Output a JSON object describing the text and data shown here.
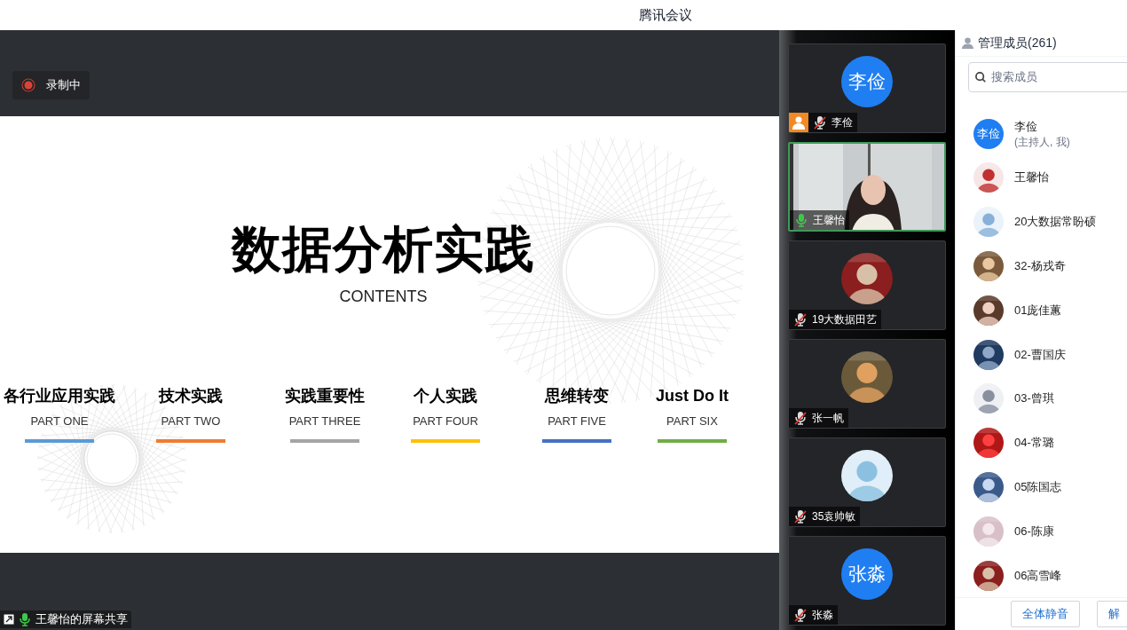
{
  "window": {
    "title": "腾讯会议"
  },
  "recording": {
    "label": "录制中"
  },
  "slide": {
    "title": "数据分析实践",
    "subtitle": "CONTENTS",
    "parts": [
      {
        "title": "各行业应用实践",
        "label": "PART ONE",
        "color": "#5b9bd5"
      },
      {
        "title": "技术实践",
        "label": "PART TWO",
        "color": "#ed7d31"
      },
      {
        "title": "实践重要性",
        "label": "PART THREE",
        "color": "#a5a5a5"
      },
      {
        "title": "个人实践",
        "label": "PART FOUR",
        "color": "#ffc000"
      },
      {
        "title": "思维转变",
        "label": "PART FIVE",
        "color": "#4472c4"
      },
      {
        "title": "Just Do It",
        "label": "PART SIX",
        "color": "#70ad47"
      }
    ]
  },
  "share_label": {
    "text": "王馨怡的屏幕共享",
    "muted": false
  },
  "video_tiles": [
    {
      "name": "李俭",
      "kind": "text_avatar",
      "avatar_text": "李俭",
      "muted": true,
      "speaking": false,
      "host": true
    },
    {
      "name": "王馨怡",
      "kind": "video",
      "muted": false,
      "speaking": true,
      "host": false
    },
    {
      "name": "19大数据田艺",
      "kind": "picture_avatar",
      "muted": true,
      "speaking": false,
      "host": false
    },
    {
      "name": "张一帆",
      "kind": "picture_avatar",
      "muted": true,
      "speaking": false,
      "host": false
    },
    {
      "name": "35袁帅敏",
      "kind": "picture_avatar",
      "muted": true,
      "speaking": false,
      "host": false
    },
    {
      "name": "张淼",
      "kind": "text_avatar",
      "avatar_text": "张淼",
      "muted": true,
      "speaking": false,
      "host": false
    }
  ],
  "members": {
    "title": "管理成员(261)",
    "search": {
      "placeholder": "搜索成员"
    },
    "items": [
      {
        "name": "李俭",
        "note": "(主持人, 我)",
        "kind": "text_avatar",
        "avatar_text": "李俭"
      },
      {
        "name": "王馨怡",
        "kind": "picture"
      },
      {
        "name": "20大数据常盼硕",
        "kind": "picture"
      },
      {
        "name": "32-杨戎奇",
        "kind": "picture"
      },
      {
        "name": "01庞佳蕙",
        "kind": "picture"
      },
      {
        "name": "02-曹国庆",
        "kind": "picture"
      },
      {
        "name": "03-曾琪",
        "kind": "picture"
      },
      {
        "name": "04-常璐",
        "kind": "picture"
      },
      {
        "name": "05陈国志",
        "kind": "picture"
      },
      {
        "name": "06-陈康",
        "kind": "picture"
      },
      {
        "name": "06高雪峰",
        "kind": "picture"
      }
    ],
    "buttons": [
      "全体静音",
      "解"
    ]
  }
}
